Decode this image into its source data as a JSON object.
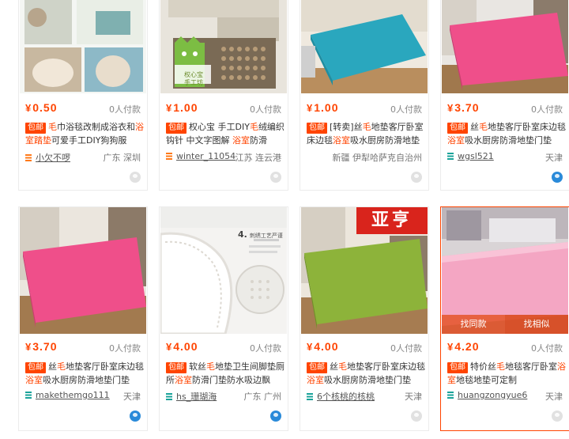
{
  "products": [
    {
      "price": "0.50",
      "sold": "0人付款",
      "tag": "包邮",
      "title_parts": [
        "毛",
        "巾浴毯改制成浴衣和",
        "浴室踏垫",
        "可爱手工DIY狗狗服"
      ],
      "shop": "小欠不啰",
      "location": "广东 深圳",
      "shop_color": "#ff7a1a",
      "online": false
    },
    {
      "price": "1.00",
      "sold": "0人付款",
      "tag": "包邮",
      "title_parts": [
        "权心宝 手工DIY",
        "毛",
        "绒编织钩针 中文字图解 ",
        "浴室",
        "防滑"
      ],
      "shop": "winter_11054",
      "location": "江苏 连云港",
      "shop_color": "#ff7a1a",
      "online": false,
      "img_text": [
        "权心宝",
        "手工坊"
      ]
    },
    {
      "price": "1.00",
      "sold": "0人付款",
      "tag": "包邮",
      "title_parts": [
        "[转卖]丝",
        "毛",
        "地垫客厅卧室床边毯",
        "浴室",
        "吸水厨房防滑地垫"
      ],
      "shop": "",
      "location": "新疆 伊犁哈萨克自治州",
      "shop_color": "#ff7a1a",
      "online": false
    },
    {
      "price": "3.70",
      "sold": "0人付款",
      "tag": "包邮",
      "title_parts": [
        "丝",
        "毛",
        "地垫客厅卧室床边毯",
        "浴室",
        "吸水厨房防滑地垫门垫"
      ],
      "shop": "wgsl521",
      "location": "天津",
      "shop_color": "#1aa39a",
      "online": true
    },
    {
      "price": "3.70",
      "sold": "0人付款",
      "tag": "包邮",
      "title_parts": [
        "丝",
        "毛",
        "地垫客厅卧室床边毯",
        "浴室",
        "吸水厨房防滑地垫门垫"
      ],
      "shop": "makethemgo111",
      "location": "天津",
      "shop_color": "#1aa39a",
      "online": true
    },
    {
      "price": "4.00",
      "sold": "0人付款",
      "tag": "包邮",
      "title_parts": [
        "软丝",
        "毛",
        "地垫卫生间脚垫厕所",
        "浴室",
        "防滑门垫防水吸边飘"
      ],
      "shop": "hs_珊瑚海",
      "location": "广东 广州",
      "shop_color": "#1aa39a",
      "online": true,
      "img_text": [
        "4.",
        "刺绣工艺严谨"
      ]
    },
    {
      "price": "4.00",
      "sold": "0人付款",
      "tag": "包邮",
      "title_parts": [
        "丝",
        "毛",
        "地垫客厅卧室床边毯",
        "浴室",
        "吸水厨房防滑地垫门垫"
      ],
      "shop": "6个核桃的核桃",
      "location": "天津",
      "shop_color": "#1aa39a",
      "online": false,
      "img_text": [
        "亚亨"
      ]
    },
    {
      "price": "4.20",
      "sold": "0人付款",
      "tag": "包邮",
      "title_parts": [
        "特价丝",
        "毛",
        "地毯客厅卧室",
        "浴室",
        "地毯地垫可定制"
      ],
      "shop": "huangzongyue6",
      "location": "天津",
      "shop_color": "#1aa39a",
      "online": false,
      "hover": [
        "找同款",
        "找相似"
      ]
    }
  ],
  "currency": "¥"
}
